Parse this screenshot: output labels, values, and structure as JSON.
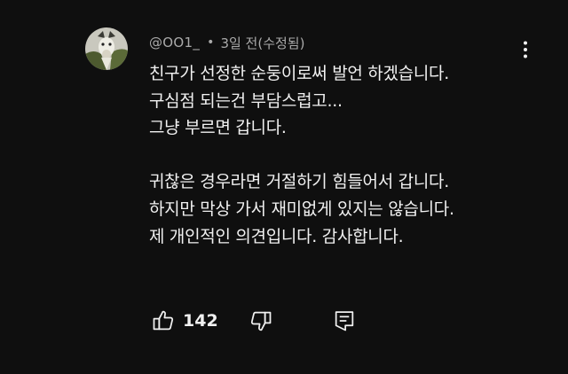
{
  "comment": {
    "author": "@OO1_",
    "separator": "•",
    "time": "3일 전",
    "edited": "(수정됨)",
    "lines": [
      "친구가 선정한 순둥이로써 발언 하겠습니다.",
      "구심점 되는건 부담스럽고...",
      "그냥 부르면 갑니다.",
      "",
      "귀찮은 경우라면 거절하기 힘들어서 갑니다.",
      "하지만 막상 가서 재미없게 있지는 않습니다.",
      "제 개인적인 의견입니다. 감사합니다."
    ]
  },
  "actions": {
    "like_count": "142"
  },
  "icons": {
    "more": "more-vert-icon",
    "like": "thumbs-up-icon",
    "dislike": "thumbs-down-icon",
    "reply": "reply-comment-icon"
  },
  "colors": {
    "background": "#0f0f0f",
    "text": "#f1f1f1",
    "secondary_text": "#aaaaaa"
  }
}
